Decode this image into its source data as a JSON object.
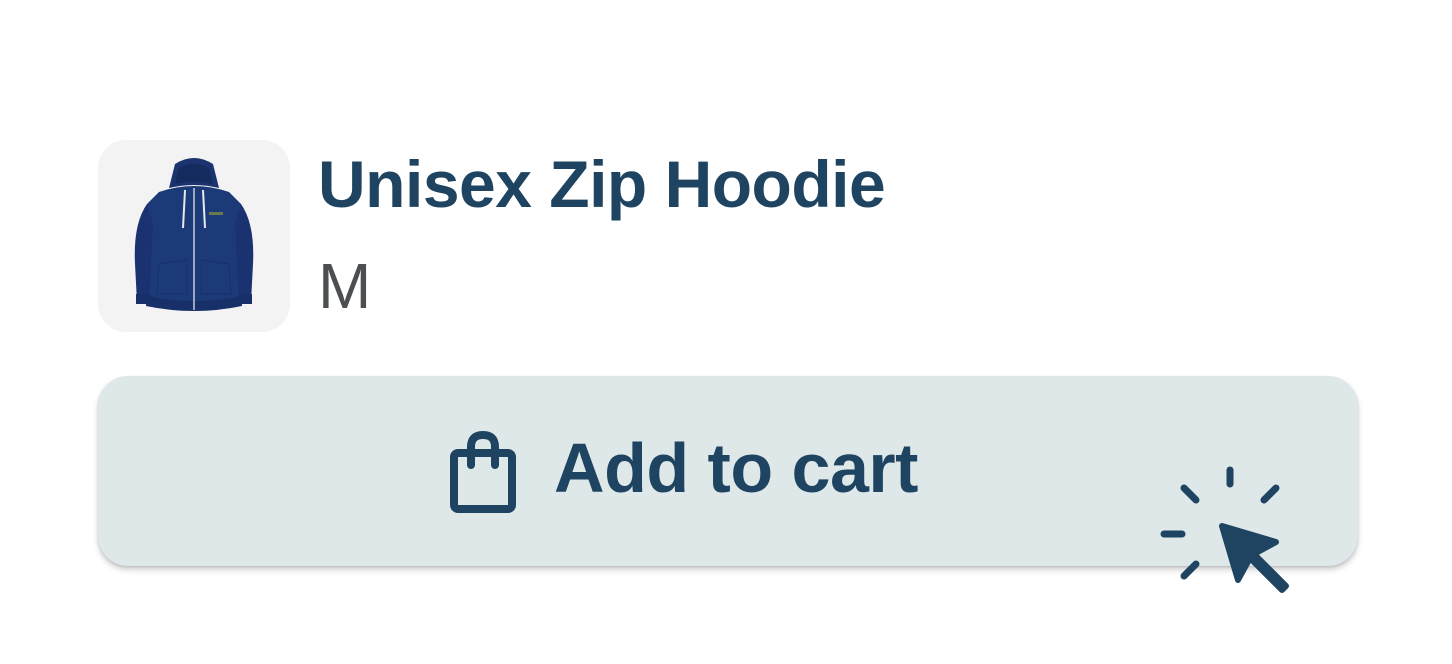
{
  "product": {
    "name": "Unisex Zip Hoodie",
    "variant": "M"
  },
  "cart_button": {
    "label": "Add to cart"
  },
  "colors": {
    "text_primary": "#1e4461",
    "text_secondary": "#4b4f52",
    "button_bg": "#dfe8e8",
    "thumb_bg": "#f3f3f3",
    "hoodie": "#1d3a78"
  },
  "icons": {
    "bag": "shopping-bag-icon",
    "cursor": "click-pointer-icon"
  }
}
